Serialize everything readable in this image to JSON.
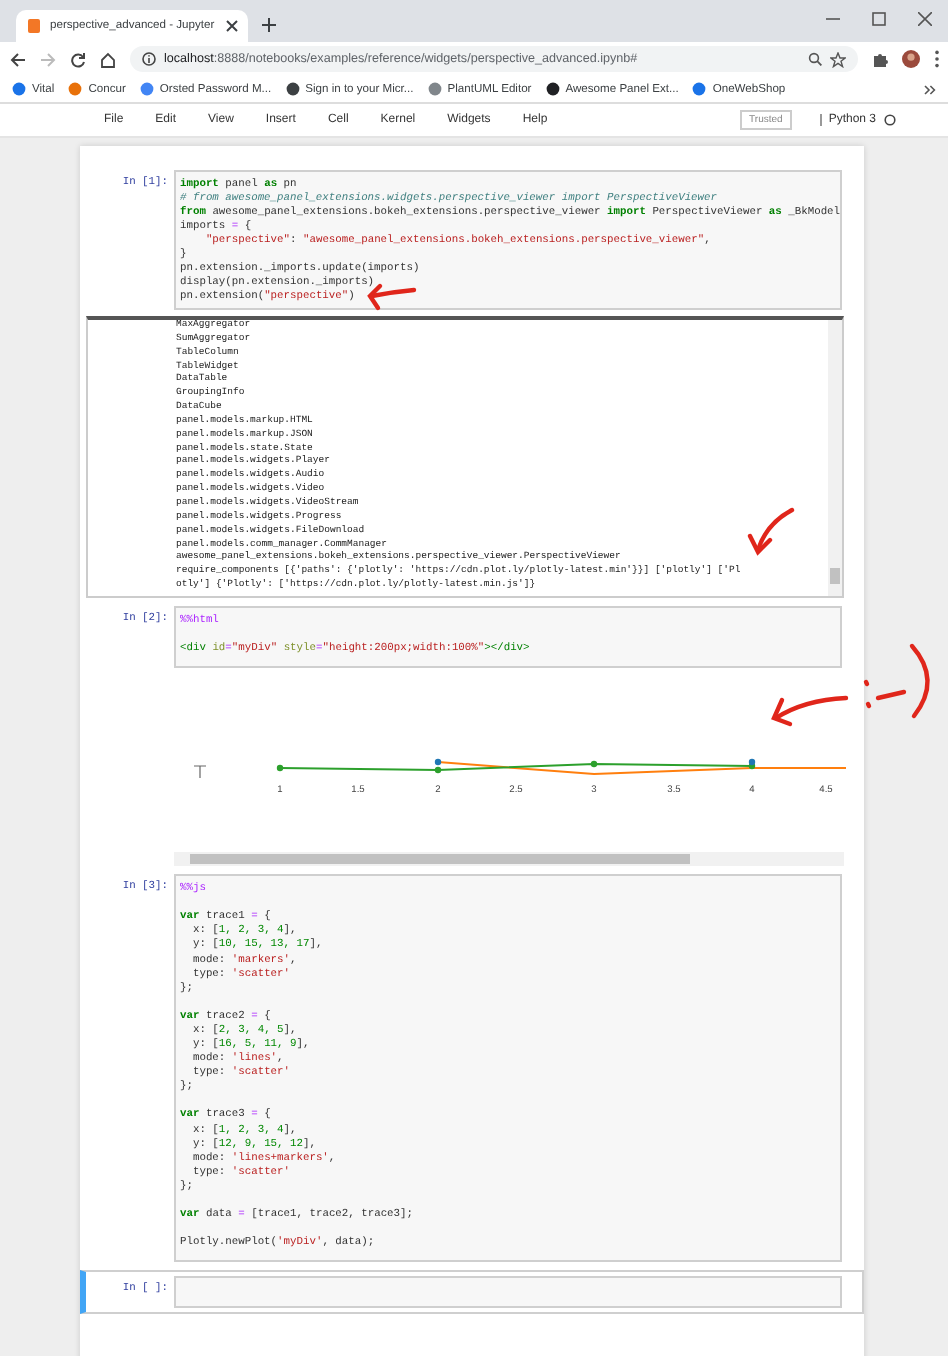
{
  "browser": {
    "tab_title": "perspective_advanced - Jupyter",
    "address": {
      "host": "localhost",
      "path": ":8888/notebooks/examples/reference/widgets/perspective_advanced.ipynb#"
    },
    "bookmarks": [
      {
        "label": "Vital",
        "color": "#1a73e8"
      },
      {
        "label": "Concur",
        "color": "#e8710a"
      },
      {
        "label": "Orsted Password M...",
        "color": "#4285f4"
      },
      {
        "label": "Sign in to your Micr...",
        "color": "#3c4043"
      },
      {
        "label": "PlantUML Editor",
        "color": "#80868b"
      },
      {
        "label": "Awesome Panel Ext...",
        "color": "#202124"
      },
      {
        "label": "OneWebShop",
        "color": "#1a73e8"
      }
    ]
  },
  "notebook": {
    "menu": [
      "File",
      "Edit",
      "View",
      "Insert",
      "Cell",
      "Kernel",
      "Widgets",
      "Help"
    ],
    "trusted": "Trusted",
    "kernel": "Python 3"
  },
  "cells": [
    {
      "prompt": "In [1]:",
      "selected": false,
      "lines": [
        {
          "kind": "code",
          "tokens": [
            {
              "kind": "kw",
              "text": "import"
            },
            {
              "kind": "plain",
              "text": " panel "
            },
            {
              "kind": "kw",
              "text": "as"
            },
            {
              "kind": "plain",
              "text": " pn"
            }
          ]
        },
        {
          "kind": "code",
          "tokens": [
            {
              "kind": "com",
              "text": "# from awesome_panel_extensions.widgets.perspective_viewer import PerspectiveViewer"
            }
          ]
        },
        {
          "kind": "code",
          "tokens": [
            {
              "kind": "kw",
              "text": "from"
            },
            {
              "kind": "plain",
              "text": " awesome_panel_extensions.bokeh_extensions.perspective_viewer "
            },
            {
              "kind": "kw",
              "text": "import"
            },
            {
              "kind": "plain",
              "text": " PerspectiveViewer "
            },
            {
              "kind": "kw",
              "text": "as"
            },
            {
              "kind": "plain",
              "text": " _BkModel"
            }
          ]
        },
        {
          "kind": "code",
          "tokens": [
            {
              "kind": "plain",
              "text": "imports "
            },
            {
              "kind": "op",
              "text": "="
            },
            {
              "kind": "plain",
              "text": " {"
            }
          ]
        },
        {
          "kind": "code",
          "tokens": [
            {
              "kind": "str",
              "text": "    \"perspective\""
            },
            {
              "kind": "plain",
              "text": ": "
            },
            {
              "kind": "str",
              "text": "\"awesome_panel_extensions.bokeh_extensions.perspective_viewer\""
            },
            {
              "kind": "plain",
              "text": ","
            }
          ]
        },
        {
          "kind": "code",
          "tokens": [
            {
              "kind": "plain",
              "text": "}"
            }
          ]
        },
        {
          "kind": "code",
          "tokens": [
            {
              "kind": "plain",
              "text": "pn.extension._imports.update(imports)"
            }
          ]
        },
        {
          "kind": "code",
          "tokens": [
            {
              "kind": "plain",
              "text": "display(pn.extension._imports)"
            }
          ]
        },
        {
          "kind": "code",
          "tokens": [
            {
              "kind": "plain",
              "text": "pn.extension("
            },
            {
              "kind": "str",
              "text": "\"perspective\""
            },
            {
              "kind": "plain",
              "text": ")"
            }
          ]
        }
      ],
      "output": {
        "kind": "text",
        "lines": [
          "MaxAggregator",
          "SumAggregator",
          "TableColumn",
          "TableWidget",
          "DataTable",
          "GroupingInfo",
          "DataCube",
          "panel.models.markup.HTML",
          "panel.models.markup.JSON",
          "panel.models.state.State",
          "panel.models.widgets.Player",
          "panel.models.widgets.Audio",
          "panel.models.widgets.Video",
          "panel.models.widgets.VideoStream",
          "panel.models.widgets.Progress",
          "panel.models.widgets.FileDownload",
          "panel.models.comm_manager.CommManager",
          "awesome_panel_extensions.bokeh_extensions.perspective_viewer.PerspectiveViewer",
          "require_components [{'paths': {'plotly': 'https://cdn.plot.ly/plotly-latest.min'}}] ['plotly'] ['Pl",
          "otly'] {'Plotly': ['https://cdn.plot.ly/plotly-latest.min.js']}"
        ]
      }
    },
    {
      "prompt": "In [2]:",
      "selected": false,
      "lines": [
        {
          "kind": "code",
          "tokens": [
            {
              "kind": "magic",
              "text": "%%html"
            }
          ]
        },
        {
          "kind": "blank"
        },
        {
          "kind": "code",
          "tokens": [
            {
              "kind": "tag",
              "text": "<div "
            },
            {
              "kind": "attr",
              "text": "id"
            },
            {
              "kind": "op",
              "text": "="
            },
            {
              "kind": "str",
              "text": "\"myDiv\" "
            },
            {
              "kind": "attr",
              "text": "style"
            },
            {
              "kind": "op",
              "text": "="
            },
            {
              "kind": "str",
              "text": "\"height:200px;width:100%\""
            },
            {
              "kind": "tag",
              "text": "></div>"
            }
          ]
        }
      ],
      "output": {
        "kind": "plot",
        "x_tick_labels": [
          "1",
          "1.5",
          "2",
          "2.5",
          "3",
          "3.5",
          "4",
          "4.5"
        ]
      }
    },
    {
      "prompt": "In [3]:",
      "selected": false,
      "lines": [
        {
          "kind": "code",
          "tokens": [
            {
              "kind": "magic",
              "text": "%%js"
            }
          ]
        },
        {
          "kind": "blank"
        },
        {
          "kind": "code",
          "tokens": [
            {
              "kind": "kw",
              "text": "var"
            },
            {
              "kind": "plain",
              "text": " trace1 "
            },
            {
              "kind": "op",
              "text": "="
            },
            {
              "kind": "plain",
              "text": " {"
            }
          ]
        },
        {
          "kind": "code",
          "tokens": [
            {
              "kind": "plain",
              "text": "  x: ["
            },
            {
              "kind": "num",
              "text": "1, 2, 3, 4"
            },
            {
              "kind": "plain",
              "text": "],"
            }
          ]
        },
        {
          "kind": "code",
          "tokens": [
            {
              "kind": "plain",
              "text": "  y: ["
            },
            {
              "kind": "num",
              "text": "10, 15, 13, 17"
            },
            {
              "kind": "plain",
              "text": "],"
            }
          ]
        },
        {
          "kind": "code",
          "tokens": [
            {
              "kind": "plain",
              "text": "  mode: "
            },
            {
              "kind": "str",
              "text": "'markers'"
            },
            {
              "kind": "plain",
              "text": ","
            }
          ]
        },
        {
          "kind": "code",
          "tokens": [
            {
              "kind": "plain",
              "text": "  type: "
            },
            {
              "kind": "str",
              "text": "'scatter'"
            }
          ]
        },
        {
          "kind": "code",
          "tokens": [
            {
              "kind": "plain",
              "text": "};"
            }
          ]
        },
        {
          "kind": "blank"
        },
        {
          "kind": "code",
          "tokens": [
            {
              "kind": "kw",
              "text": "var"
            },
            {
              "kind": "plain",
              "text": " trace2 "
            },
            {
              "kind": "op",
              "text": "="
            },
            {
              "kind": "plain",
              "text": " {"
            }
          ]
        },
        {
          "kind": "code",
          "tokens": [
            {
              "kind": "plain",
              "text": "  x: ["
            },
            {
              "kind": "num",
              "text": "2, 3, 4, 5"
            },
            {
              "kind": "plain",
              "text": "],"
            }
          ]
        },
        {
          "kind": "code",
          "tokens": [
            {
              "kind": "plain",
              "text": "  y: ["
            },
            {
              "kind": "num",
              "text": "16, 5, 11, 9"
            },
            {
              "kind": "plain",
              "text": "],"
            }
          ]
        },
        {
          "kind": "code",
          "tokens": [
            {
              "kind": "plain",
              "text": "  mode: "
            },
            {
              "kind": "str",
              "text": "'lines'"
            },
            {
              "kind": "plain",
              "text": ","
            }
          ]
        },
        {
          "kind": "code",
          "tokens": [
            {
              "kind": "plain",
              "text": "  type: "
            },
            {
              "kind": "str",
              "text": "'scatter'"
            }
          ]
        },
        {
          "kind": "code",
          "tokens": [
            {
              "kind": "plain",
              "text": "};"
            }
          ]
        },
        {
          "kind": "blank"
        },
        {
          "kind": "code",
          "tokens": [
            {
              "kind": "kw",
              "text": "var"
            },
            {
              "kind": "plain",
              "text": " trace3 "
            },
            {
              "kind": "op",
              "text": "="
            },
            {
              "kind": "plain",
              "text": " {"
            }
          ]
        },
        {
          "kind": "code",
          "tokens": [
            {
              "kind": "plain",
              "text": "  x: ["
            },
            {
              "kind": "num",
              "text": "1, 2, 3, 4"
            },
            {
              "kind": "plain",
              "text": "],"
            }
          ]
        },
        {
          "kind": "code",
          "tokens": [
            {
              "kind": "plain",
              "text": "  y: ["
            },
            {
              "kind": "num",
              "text": "12, 9, 15, 12"
            },
            {
              "kind": "plain",
              "text": "],"
            }
          ]
        },
        {
          "kind": "code",
          "tokens": [
            {
              "kind": "plain",
              "text": "  mode: "
            },
            {
              "kind": "str",
              "text": "'lines+markers'"
            },
            {
              "kind": "plain",
              "text": ","
            }
          ]
        },
        {
          "kind": "code",
          "tokens": [
            {
              "kind": "plain",
              "text": "  type: "
            },
            {
              "kind": "str",
              "text": "'scatter'"
            }
          ]
        },
        {
          "kind": "code",
          "tokens": [
            {
              "kind": "plain",
              "text": "};"
            }
          ]
        },
        {
          "kind": "blank"
        },
        {
          "kind": "code",
          "tokens": [
            {
              "kind": "kw",
              "text": "var"
            },
            {
              "kind": "plain",
              "text": " data "
            },
            {
              "kind": "op",
              "text": "="
            },
            {
              "kind": "plain",
              "text": " [trace1, trace2, trace3];"
            }
          ]
        },
        {
          "kind": "blank"
        },
        {
          "kind": "code",
          "tokens": [
            {
              "kind": "plain",
              "text": "Plotly.newPlot("
            },
            {
              "kind": "str",
              "text": "'myDiv'"
            },
            {
              "kind": "plain",
              "text": ", data);"
            }
          ]
        }
      ]
    },
    {
      "prompt": "In [ ]:",
      "selected": true
    }
  ]
}
